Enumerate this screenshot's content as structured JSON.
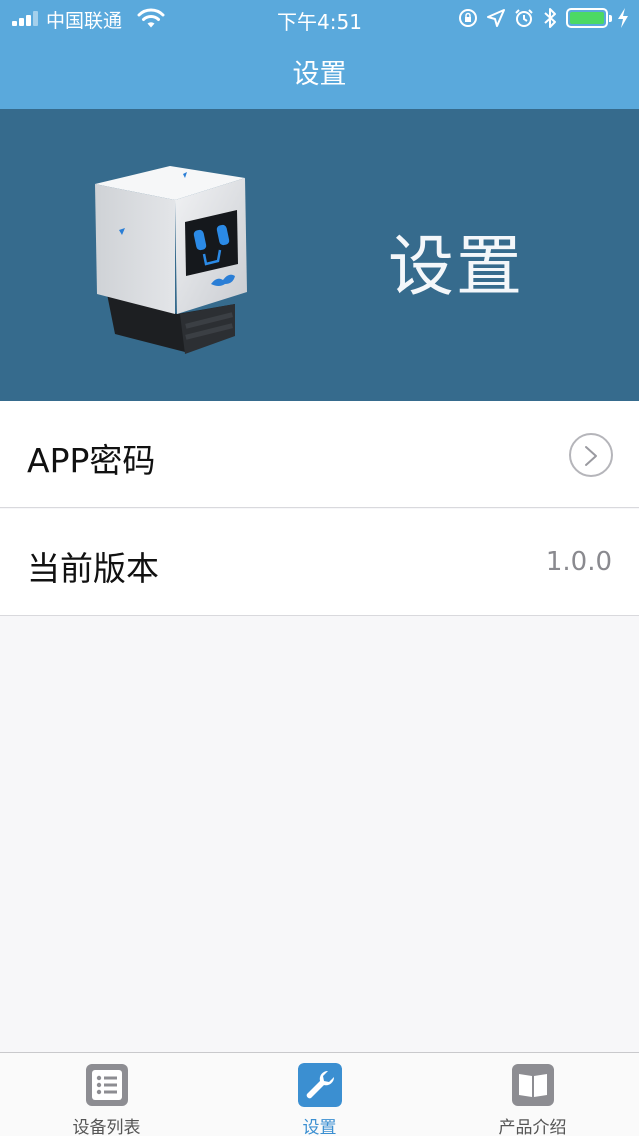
{
  "status_bar": {
    "carrier": "中国联通",
    "time": "下午4:51",
    "battery_level": 1.0,
    "battery_color": "#4cd964"
  },
  "nav": {
    "title": "设置"
  },
  "banner": {
    "title": "设置",
    "background": "#366b8d",
    "image": "robot-mascot"
  },
  "settings": {
    "app_password": {
      "label": "APP密码",
      "icon": "chevron-right-circle-icon"
    },
    "version": {
      "label": "当前版本",
      "value": "1.0.0"
    }
  },
  "tabbar": {
    "active": "settings",
    "accent": "#3b8fd1",
    "tabs": [
      {
        "label": "设备列表",
        "icon": "list-icon"
      },
      {
        "label": "设置",
        "icon": "wrench-icon"
      },
      {
        "label": "产品介绍",
        "icon": "book-icon"
      }
    ]
  }
}
